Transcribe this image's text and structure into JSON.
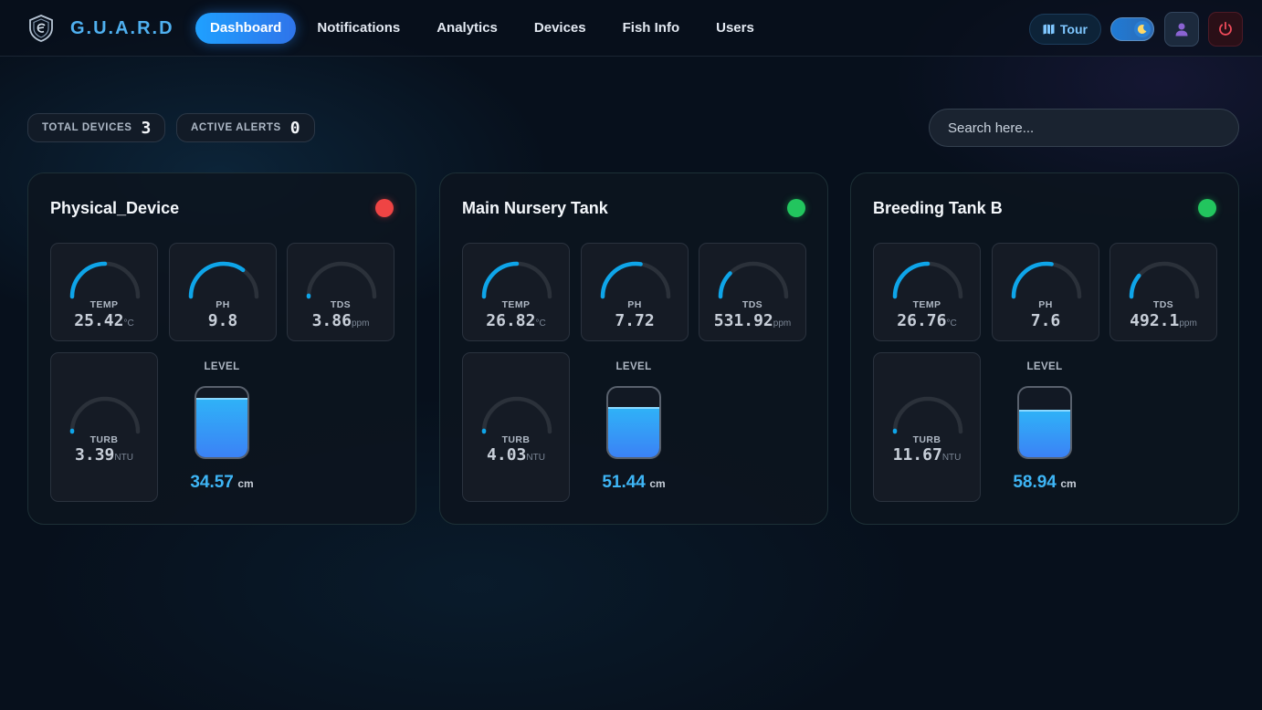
{
  "brand": {
    "name": "G.U.A.R.D"
  },
  "nav": {
    "links": [
      "Dashboard",
      "Notifications",
      "Analytics",
      "Devices",
      "Fish Info",
      "Users"
    ],
    "active": "Dashboard",
    "tour_label": "Tour"
  },
  "stats": {
    "total_devices_label": "TOTAL DEVICES",
    "total_devices": "3",
    "active_alerts_label": "ACTIVE ALERTS",
    "active_alerts": "0"
  },
  "search": {
    "placeholder": "Search here..."
  },
  "colors": {
    "accent": "#1fa0ff",
    "online": "#22c55e",
    "offline": "#ef4444",
    "gauge_track": "#2b313a"
  },
  "devices": [
    {
      "name": "Physical_Device",
      "status": "offline",
      "temp": {
        "label": "TEMP",
        "value": "25.42",
        "unit": "°C",
        "fill": 0.5
      },
      "ph": {
        "label": "PH",
        "value": "9.8",
        "unit": "",
        "fill": 0.7
      },
      "tds": {
        "label": "TDS",
        "value": "3.86",
        "unit": "ppm",
        "fill": 0.01
      },
      "turb": {
        "label": "TURB",
        "value": "3.39",
        "unit": "NTU",
        "fill": 0.01
      },
      "level": {
        "label": "LEVEL",
        "value": "34.57",
        "unit": "cm",
        "fill": 0.85
      }
    },
    {
      "name": "Main Nursery Tank",
      "status": "online",
      "temp": {
        "label": "TEMP",
        "value": "26.82",
        "unit": "°C",
        "fill": 0.5
      },
      "ph": {
        "label": "PH",
        "value": "7.72",
        "unit": "",
        "fill": 0.55
      },
      "tds": {
        "label": "TDS",
        "value": "531.92",
        "unit": "ppm",
        "fill": 0.25
      },
      "turb": {
        "label": "TURB",
        "value": "4.03",
        "unit": "NTU",
        "fill": 0.01
      },
      "level": {
        "label": "LEVEL",
        "value": "51.44",
        "unit": "cm",
        "fill": 0.72
      }
    },
    {
      "name": "Breeding Tank B",
      "status": "online",
      "temp": {
        "label": "TEMP",
        "value": "26.76",
        "unit": "°C",
        "fill": 0.5
      },
      "ph": {
        "label": "PH",
        "value": "7.6",
        "unit": "",
        "fill": 0.55
      },
      "tds": {
        "label": "TDS",
        "value": "492.1",
        "unit": "ppm",
        "fill": 0.22
      },
      "turb": {
        "label": "TURB",
        "value": "11.67",
        "unit": "NTU",
        "fill": 0.01
      },
      "level": {
        "label": "LEVEL",
        "value": "58.94",
        "unit": "cm",
        "fill": 0.68
      }
    }
  ]
}
